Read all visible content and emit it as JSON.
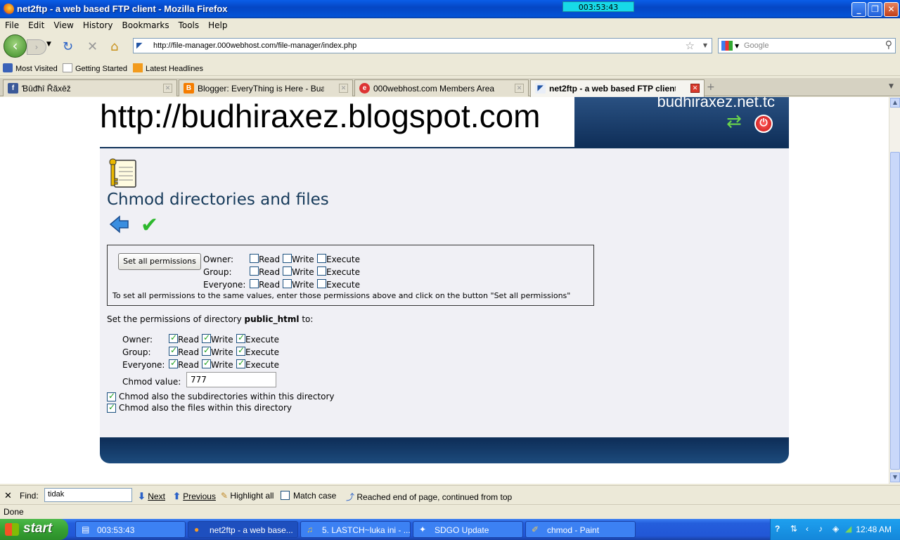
{
  "window": {
    "title": "net2ftp - a web based FTP client - Mozilla Firefox",
    "timer": "003:53:43"
  },
  "menu": [
    "File",
    "Edit",
    "View",
    "History",
    "Bookmarks",
    "Tools",
    "Help"
  ],
  "navbar": {
    "url": "http://file-manager.000webhost.com/file-manager/index.php",
    "search_placeholder": "Google"
  },
  "bookmarks": [
    "Most Visited",
    "Getting Started",
    "Latest Headlines"
  ],
  "tabs": [
    {
      "label": "Ɓûđħî Řãxēž",
      "icon": "facebook-icon"
    },
    {
      "label": "Blogger: EveryThing is Here - Buat Entri",
      "icon": "blogger-icon"
    },
    {
      "label": "000webhost.com Members Area",
      "icon": "webhost-icon"
    },
    {
      "label": "net2ftp - a web based FTP client",
      "icon": "net2ftp-icon"
    }
  ],
  "page": {
    "site_url": "http://budhiraxez.blogspot.com",
    "banner_text": "budhiraxez.net.tc",
    "title": "Chmod directories and files",
    "set_all": {
      "button": "Set all permissions",
      "rows": [
        "Owner:",
        "Group:",
        "Everyone:"
      ],
      "perm_labels": [
        "Read",
        "Write",
        "Execute"
      ],
      "checked": [
        [
          false,
          false,
          false
        ],
        [
          false,
          false,
          false
        ],
        [
          false,
          false,
          false
        ]
      ],
      "hint": "To set all permissions to the same values, enter those permissions above and click on the button \"Set all permissions\""
    },
    "directory_prefix": "Set the permissions of directory",
    "directory_name": "public_html",
    "directory_suffix": "to:",
    "dir_perms": {
      "rows": [
        "Owner:",
        "Group:",
        "Everyone:"
      ],
      "perm_labels": [
        "Read",
        "Write",
        "Execute"
      ],
      "checked": [
        [
          true,
          true,
          true
        ],
        [
          true,
          true,
          true
        ],
        [
          true,
          true,
          true
        ]
      ]
    },
    "chmod_label": "Chmod value:",
    "chmod_value": "777",
    "options": [
      {
        "label": "Chmod also the subdirectories within this directory",
        "checked": true
      },
      {
        "label": "Chmod also the files within this directory",
        "checked": true
      }
    ]
  },
  "findbar": {
    "label": "Find:",
    "value": "tidak",
    "next": "Next",
    "previous": "Previous",
    "highlight": "Highlight all",
    "match_case": "Match case",
    "message": "Reached end of page, continued from top"
  },
  "status": "Done",
  "taskbar": {
    "start": "start",
    "items": [
      "003:53:43",
      "net2ftp - a web base...",
      "5. LASTCH~luka ini - ...",
      "SDGO Update",
      "chmod - Paint"
    ],
    "clock": "12:48 AM"
  }
}
